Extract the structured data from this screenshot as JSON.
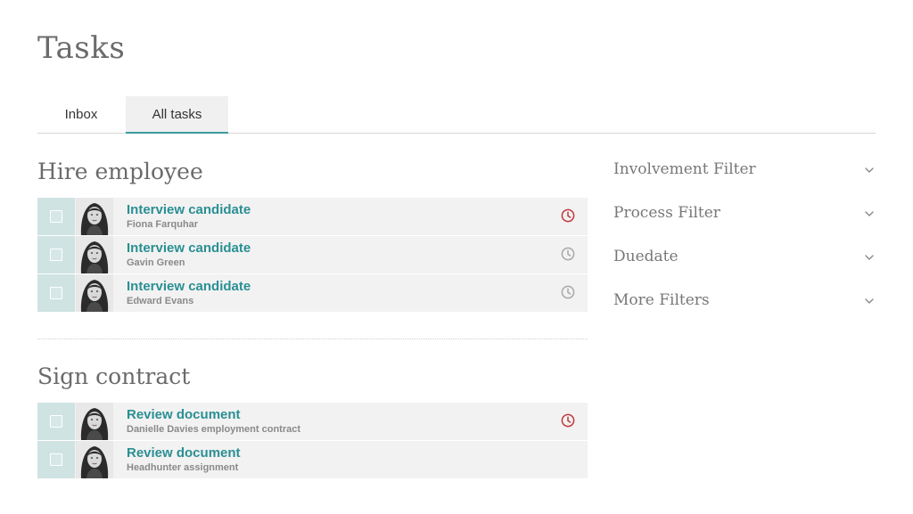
{
  "page": {
    "title": "Tasks"
  },
  "tabs": [
    {
      "label": "Inbox",
      "active": false
    },
    {
      "label": "All tasks",
      "active": true
    }
  ],
  "groups": [
    {
      "title": "Hire employee",
      "tasks": [
        {
          "name": "Interview candidate",
          "subtitle": "Fiona Farquhar",
          "clock": "overdue"
        },
        {
          "name": "Interview candidate",
          "subtitle": "Gavin Green",
          "clock": "normal"
        },
        {
          "name": "Interview candidate",
          "subtitle": "Edward Evans",
          "clock": "normal"
        }
      ]
    },
    {
      "title": "Sign contract",
      "tasks": [
        {
          "name": "Review document",
          "subtitle": "Danielle Davies employment contract",
          "clock": "overdue"
        },
        {
          "name": "Review document",
          "subtitle": "Headhunter assignment",
          "clock": "none"
        }
      ]
    }
  ],
  "filters": [
    {
      "label": "Involvement Filter"
    },
    {
      "label": "Process Filter"
    },
    {
      "label": "Duedate"
    },
    {
      "label": "More Filters"
    }
  ],
  "colors": {
    "accent": "#2a8f93",
    "overdue": "#c0393b",
    "clock_normal": "#a8a8a8",
    "check_cell": "#cfe3e3",
    "row_bg": "#f2f2f2"
  },
  "icons": {
    "clock": "clock-icon",
    "chevron": "chevron-down-icon",
    "avatar": "user-avatar"
  }
}
